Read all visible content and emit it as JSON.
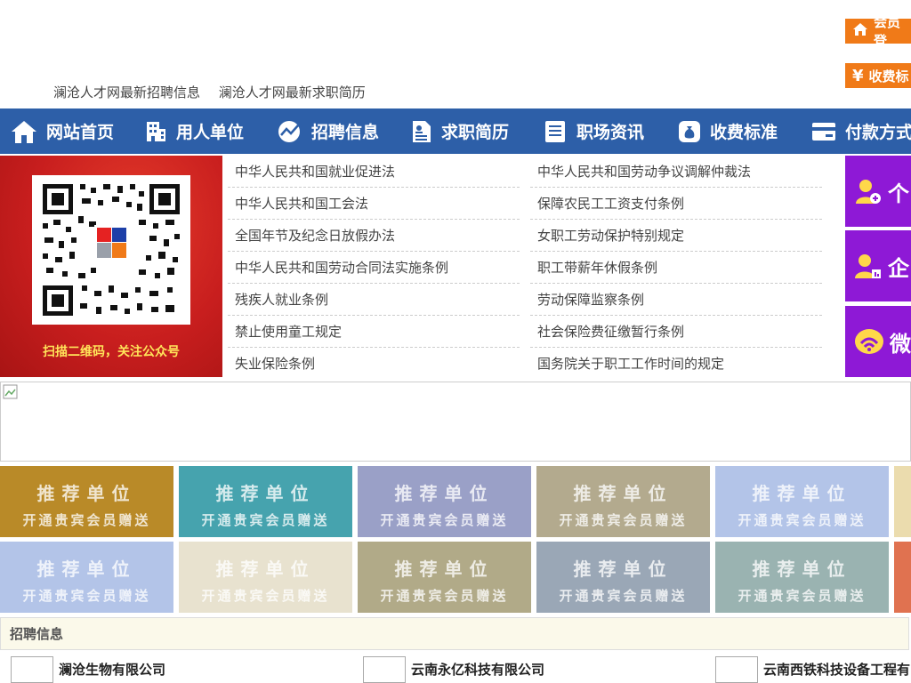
{
  "top": {
    "links": [
      "澜沧人才网最新招聘信息",
      "澜沧人才网最新求职简历"
    ],
    "member_login": "会员登",
    "fee_button": "收费标"
  },
  "nav": {
    "items": [
      {
        "label": "网站首页",
        "icon": "home-icon"
      },
      {
        "label": "用人单位",
        "icon": "building-icon"
      },
      {
        "label": "招聘信息",
        "icon": "chart-icon"
      },
      {
        "label": "求职简历",
        "icon": "resume-icon"
      },
      {
        "label": "职场资讯",
        "icon": "news-icon"
      },
      {
        "label": "收费标准",
        "icon": "money-bag-icon"
      },
      {
        "label": "付款方式",
        "icon": "card-icon"
      }
    ]
  },
  "qr": {
    "caption": "扫描二维码，关注公众号"
  },
  "laws": [
    [
      "中华人民共和国就业促进法",
      "中华人民共和国劳动争议调解仲裁法"
    ],
    [
      "中华人民共和国工会法",
      "保障农民工工资支付条例"
    ],
    [
      "全国年节及纪念日放假办法",
      "女职工劳动保护特别规定"
    ],
    [
      "中华人民共和国劳动合同法实施条例",
      "职工带薪年休假条例"
    ],
    [
      "残疾人就业条例",
      "劳动保障监察条例"
    ],
    [
      "禁止使用童工规定",
      "社会保险费征缴暂行条例"
    ],
    [
      "失业保险条例",
      "国务院关于职工工作时间的规定"
    ]
  ],
  "side": {
    "personal": "个",
    "enterprise": "企",
    "wechat": "微"
  },
  "recommend": {
    "title": "推荐单位",
    "subtitle": "开通贵宾会员赠送",
    "colors_row1": [
      "#b98a28",
      "#46a3ae",
      "#9aa0c7",
      "#b3aa8e",
      "#b3c4e8",
      "#ebdcae"
    ],
    "colors_row2": [
      "#b3c4e8",
      "#e8e2cf",
      "#b1aa88",
      "#9aa7b6",
      "#9ab3b1",
      "#e07250"
    ]
  },
  "recruit": {
    "title": "招聘信息",
    "companies": [
      "澜沧生物有限公司",
      "云南永亿科技有限公司",
      "云南西铁科技设备工程有"
    ]
  }
}
